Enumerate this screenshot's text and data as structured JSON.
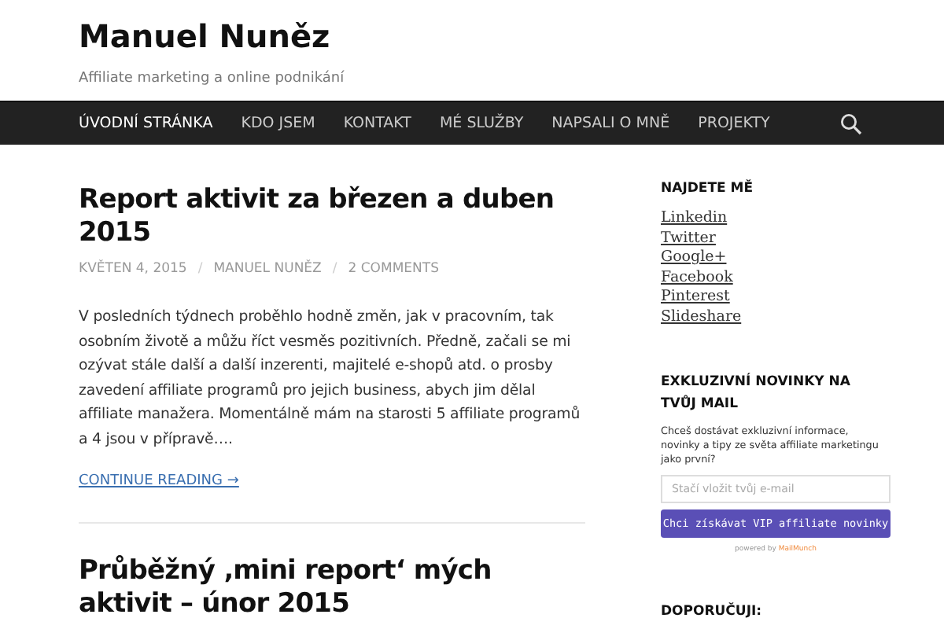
{
  "site": {
    "title": "Manuel Nuněz",
    "tagline": "Affiliate marketing a online podnikání"
  },
  "nav": {
    "items": [
      {
        "label": "ÚVODNÍ STRÁNKA",
        "selected": true
      },
      {
        "label": "KDO JSEM",
        "selected": false
      },
      {
        "label": "KONTAKT",
        "selected": false
      },
      {
        "label": "MÉ SLUŽBY",
        "selected": false
      },
      {
        "label": "NAPSALI O MNĚ",
        "selected": false
      },
      {
        "label": "PROJEKTY",
        "selected": false
      }
    ]
  },
  "posts": [
    {
      "title": "Report aktivit za březen a duben 2015",
      "date": "KVĚTEN 4, 2015",
      "separator": "/",
      "author": "MANUEL NUNĚZ",
      "comments": "2 COMMENTS",
      "excerpt": "V posledních týdnech proběhlo hodně změn, jak v pracovním, tak osobním životě a můžu říct vesměs pozitivních. Předně, začali se mi ozývat stále další a další inzerenti, majitelé e-shopů atd. o prosby zavedení affiliate programů pro jejich business, abych jim dělal affiliate manažera. Momentálně mám na starosti 5 affiliate programů a 4 jsou v přípravě….",
      "more": "CONTINUE READING →"
    },
    {
      "title": "Průběžný ‚mini report‘ mých aktivit – únor 2015"
    }
  ],
  "sidebar": {
    "widgets": [
      {
        "kind": "links",
        "title": "NAJDETE MĚ",
        "links": [
          "Linkedin",
          "Twitter",
          "Google+",
          "Facebook",
          "Pinterest",
          "Slideshare"
        ]
      },
      {
        "kind": "signup",
        "title": "EXKLUZIVNÍ NOVINKY NA TVŮJ MAIL",
        "text": "Chceš dostávat exkluzivní informace, novinky a tipy ze světa affiliate marketingu jako první?",
        "placeholder": "Stačí vložit tvůj e-mail",
        "button": "Chci získávat VIP affiliate novinky",
        "powered_by": "powered by",
        "brand": "MailMunch"
      },
      {
        "kind": "heading",
        "title": "DOPORUČUJI:"
      }
    ]
  }
}
